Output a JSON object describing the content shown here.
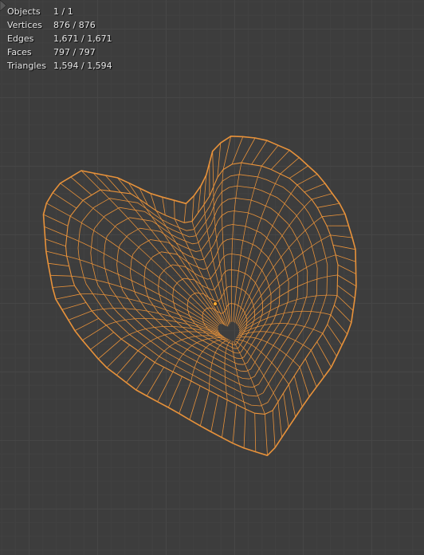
{
  "viewport": {
    "background": "#3d3d3d",
    "wire_color": "#e8923a",
    "origin_color": "#ffaa33"
  },
  "stats": {
    "objects_label": "Objects",
    "objects_value": "1 / 1",
    "vertices_label": "Vertices",
    "vertices_value": "876 / 876",
    "edges_label": "Edges",
    "edges_value": "1,671 / 1,671",
    "faces_label": "Faces",
    "faces_value": "797 / 797",
    "triangles_label": "Triangles",
    "triangles_value": "1,594 / 1,594"
  },
  "object": {
    "shape": "heart",
    "display": "wireframe",
    "selected": true
  }
}
